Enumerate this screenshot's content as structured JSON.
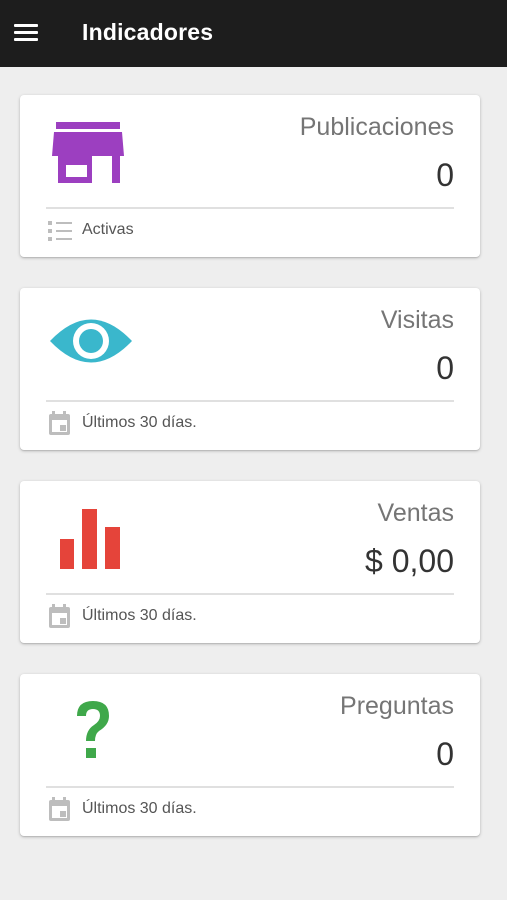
{
  "appbar": {
    "menu_icon": "hamburger-menu-icon",
    "title": "Indicadores"
  },
  "colors": {
    "appbar_bg": "#1d1d1d",
    "publicaciones": "#9c3fc0",
    "visitas": "#3ab7cc",
    "ventas": "#e5443a",
    "preguntas": "#3fa84a"
  },
  "cards": [
    {
      "icon": "store-icon",
      "title": "Publicaciones",
      "value": "0",
      "footer_icon": "list-icon",
      "footer_text": "Activas"
    },
    {
      "icon": "eye-icon",
      "title": "Visitas",
      "value": "0",
      "footer_icon": "calendar-icon",
      "footer_text": "Últimos 30 días."
    },
    {
      "icon": "bar-chart-icon",
      "title": "Ventas",
      "value": "$ 0,00",
      "footer_icon": "calendar-icon",
      "footer_text": "Últimos 30 días."
    },
    {
      "icon": "question-mark-icon",
      "title": "Preguntas",
      "value": "0",
      "footer_icon": "calendar-icon",
      "footer_text": "Últimos 30 días."
    }
  ]
}
